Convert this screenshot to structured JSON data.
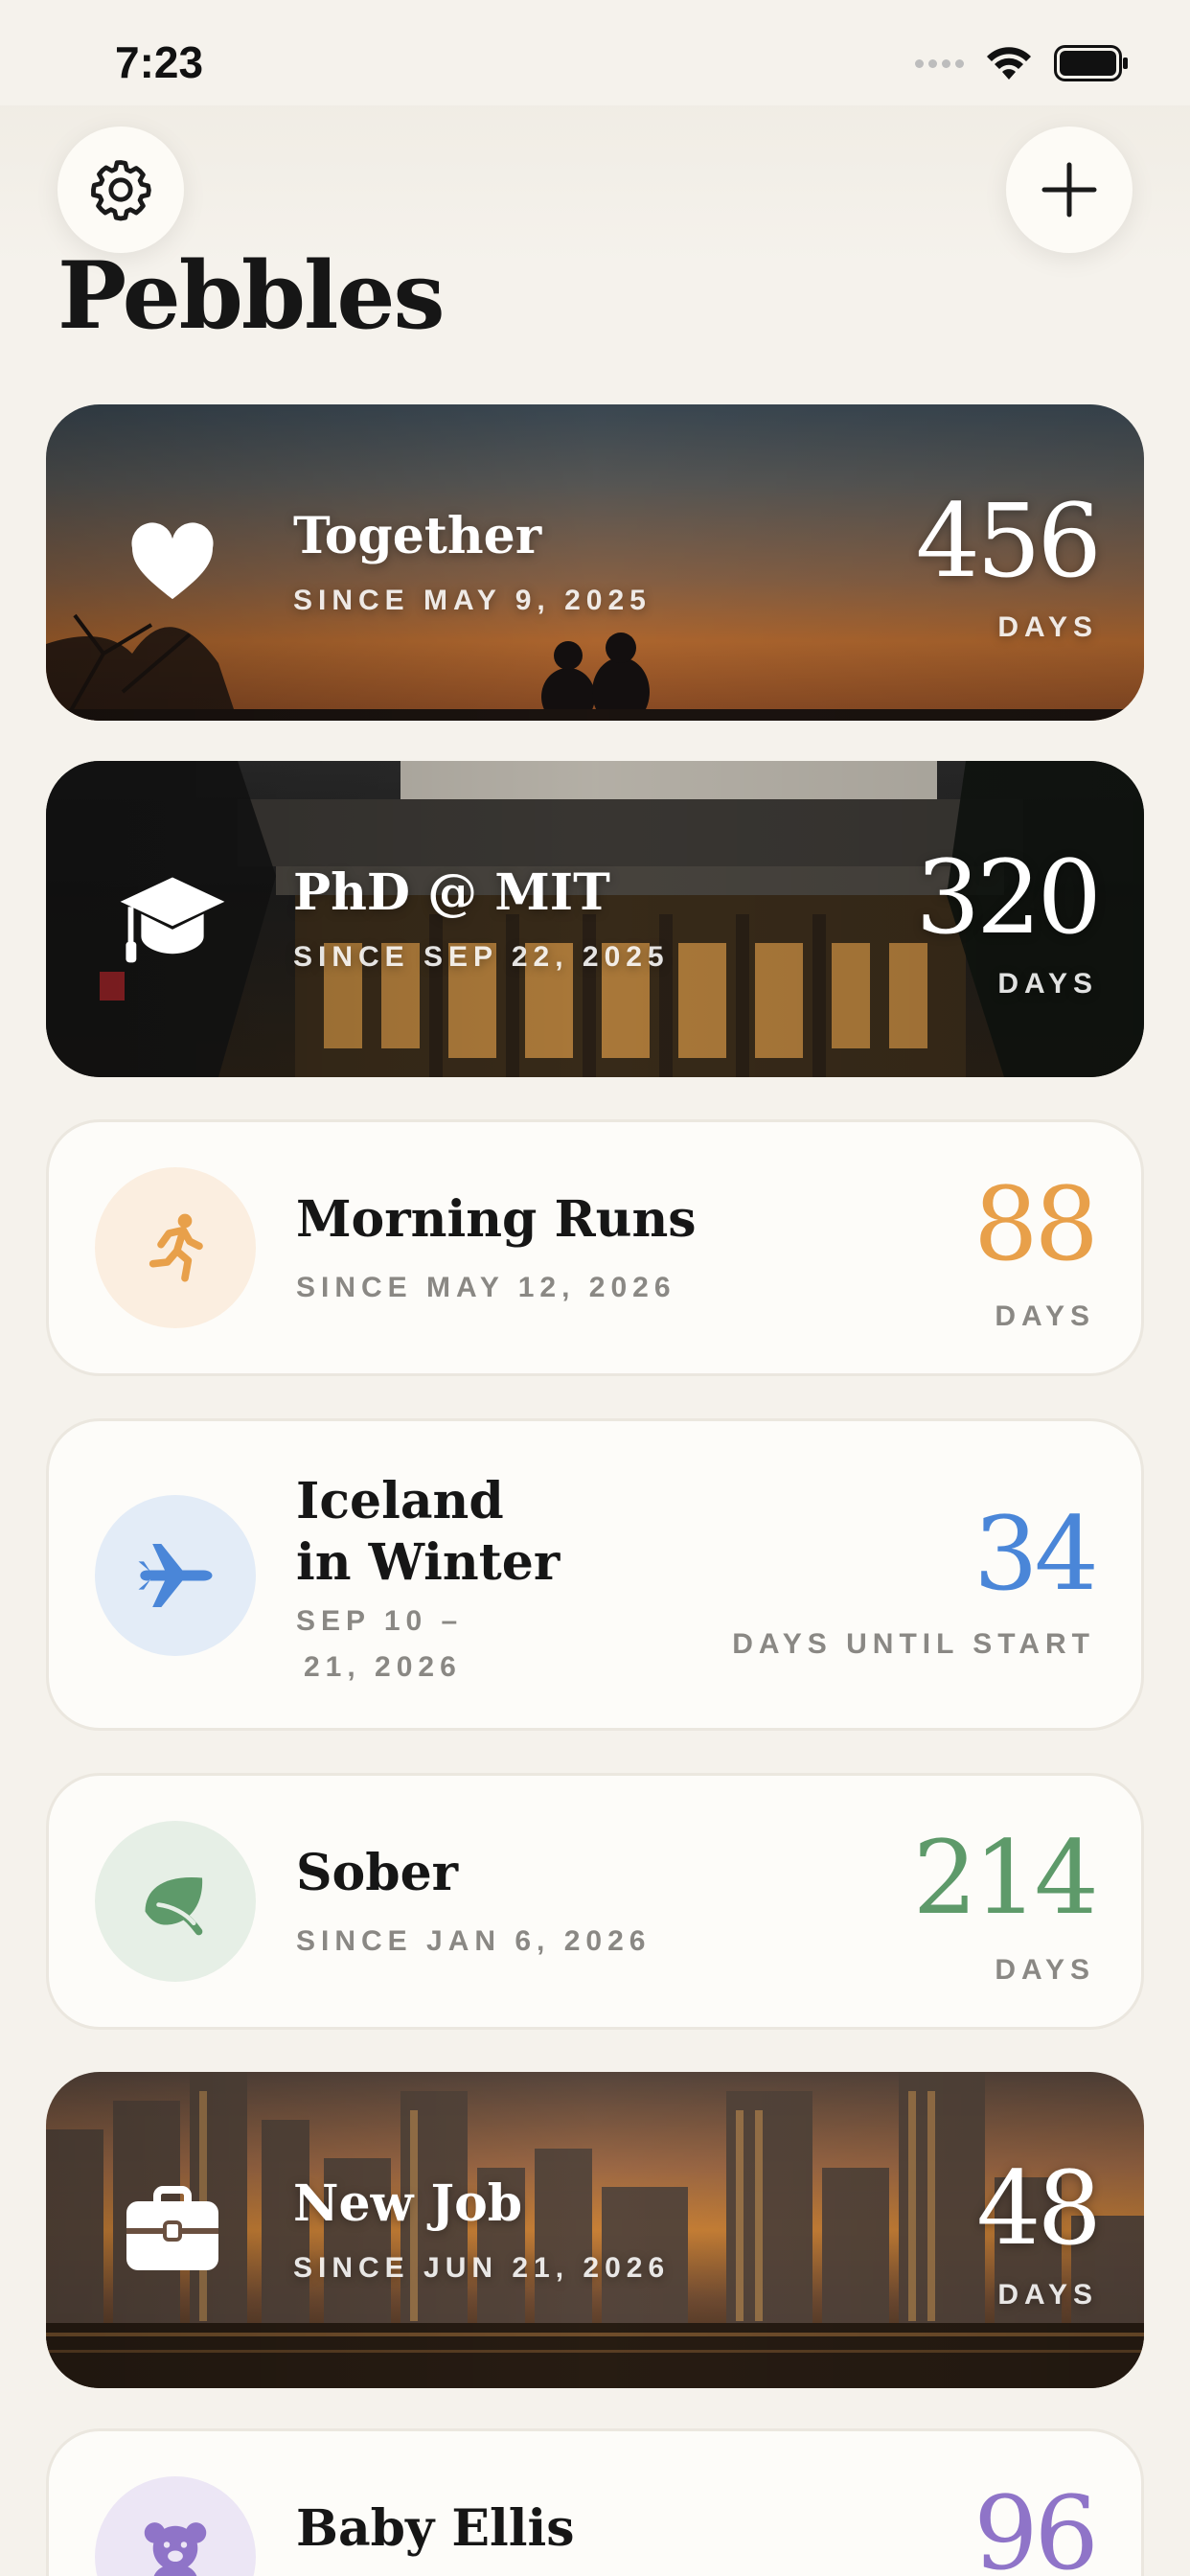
{
  "status_bar": {
    "time": "7:23"
  },
  "header": {
    "title": "Pebbles"
  },
  "colors": {
    "background": "#f5f2ec",
    "orange": "#e8a04a",
    "blue": "#4a86d8",
    "green": "#5e9a6a",
    "purple": "#8f74c8"
  },
  "cards": [
    {
      "title": "Together",
      "subtitle": "SINCE MAY 9, 2025",
      "count": "456",
      "unit": "DAYS",
      "icon": "heart-icon",
      "style": "photo-sunset"
    },
    {
      "title": "PhD @ MIT",
      "subtitle": "SINCE SEP 22, 2025",
      "count": "320",
      "unit": "DAYS",
      "icon": "graduation-cap-icon",
      "style": "photo-building"
    },
    {
      "title": "Morning Runs",
      "subtitle": "SINCE MAY 12, 2026",
      "count": "88",
      "unit": "DAYS",
      "icon": "runner-icon",
      "accent": "#e8a04a"
    },
    {
      "title_line1": "Iceland",
      "title_line2": "in Winter",
      "subtitle_line1": "SEP 10 –",
      "subtitle_line2": "21, 2026",
      "count": "34",
      "unit": "DAYS UNTIL START",
      "icon": "airplane-icon",
      "accent": "#4a86d8"
    },
    {
      "title": "Sober",
      "subtitle": "SINCE JAN 6, 2026",
      "count": "214",
      "unit": "DAYS",
      "icon": "leaf-icon",
      "accent": "#5e9a6a"
    },
    {
      "title": "New Job",
      "subtitle": "SINCE JUN 21, 2026",
      "count": "48",
      "unit": "DAYS",
      "icon": "briefcase-icon",
      "style": "photo-city"
    },
    {
      "title": "Baby Ellis",
      "count": "96",
      "icon": "teddy-bear-icon",
      "accent": "#8f74c8"
    }
  ]
}
